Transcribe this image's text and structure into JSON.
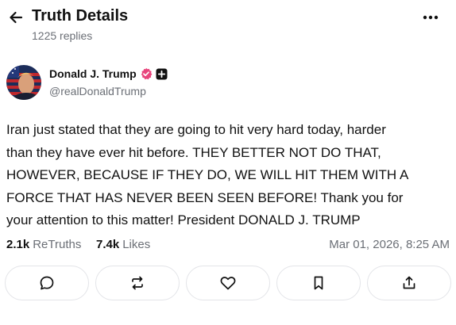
{
  "header": {
    "title": "Truth Details",
    "replies": "1225 replies",
    "back_icon": "arrow-left-icon",
    "more_icon": "more-horizontal-icon"
  },
  "post": {
    "author": {
      "display_name": "Donald J. Trump",
      "handle": "@realDonaldTrump",
      "verified_icon": "verified-badge-icon",
      "follow_icon": "plus-icon"
    },
    "text": "Iran just stated that they are going to hit very hard today, harder\nthan they have ever hit before. THEY BETTER NOT DO THAT,\nHOWEVER, BECAUSE IF THEY DO, WE WILL HIT THEM WITH A\nFORCE THAT HAS NEVER BEEN SEEN BEFORE! Thank you for\nyour attention to this matter! President DONALD J. TRUMP",
    "stats": {
      "retruths_count": "2.1k",
      "retruths_label": "ReTruths",
      "likes_count": "7.4k",
      "likes_label": "Likes",
      "timestamp": "Mar 01, 2026, 8:25 AM"
    }
  },
  "actions": [
    {
      "name": "reply",
      "icon": "comment-icon"
    },
    {
      "name": "retruth",
      "icon": "repost-icon"
    },
    {
      "name": "like",
      "icon": "heart-icon"
    },
    {
      "name": "bookmark",
      "icon": "bookmark-icon"
    },
    {
      "name": "share",
      "icon": "share-icon"
    }
  ],
  "colors": {
    "text": "#111111",
    "muted": "#6b6f76",
    "border": "#e3e4e8",
    "verified": "#e8457c"
  }
}
